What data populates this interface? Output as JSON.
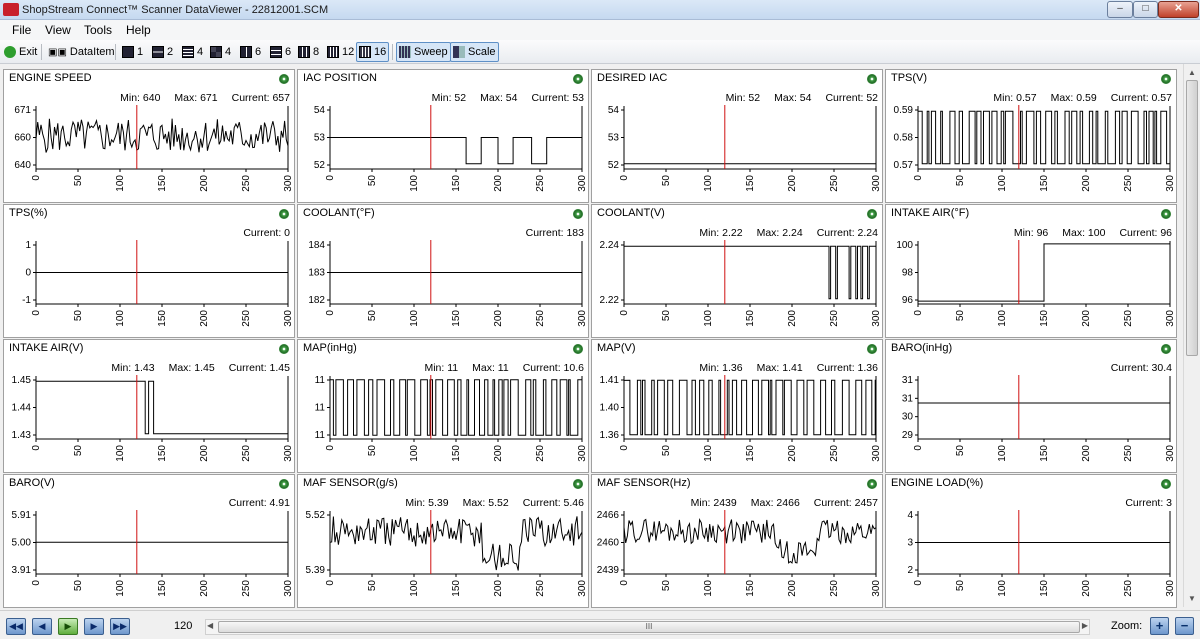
{
  "window": {
    "title": "ShopStream Connect™ Scanner DataViewer - 22812001.SCM",
    "min_label": "–",
    "max_label": "□",
    "close_label": "✕"
  },
  "menu": [
    "File",
    "View",
    "Tools",
    "Help"
  ],
  "toolbar": {
    "exit": "Exit",
    "dataitem": "DataItem",
    "layouts": [
      "1",
      "2",
      "4",
      "4",
      "6",
      "6",
      "8",
      "12",
      "16"
    ],
    "sweep": "Sweep",
    "scale": "Scale"
  },
  "panels": [
    {
      "title": "ENGINE SPEED",
      "min": "Min: 640",
      "max": "Max: 671",
      "current": "Current: 657",
      "yticks": [
        "671",
        "660",
        "640"
      ],
      "ylim": [
        638,
        674
      ],
      "trace": "noisy",
      "base": 657,
      "amp": 10
    },
    {
      "title": "IAC POSITION",
      "min": "Min: 52",
      "max": "Max: 54",
      "current": "Current: 53",
      "yticks": [
        "54",
        "53",
        "52"
      ],
      "ylim": [
        51.8,
        54.2
      ],
      "trace": "steps",
      "steps": [
        [
          0,
          53
        ],
        [
          162,
          53
        ],
        [
          162,
          52
        ],
        [
          180,
          52
        ],
        [
          180,
          53
        ],
        [
          200,
          53
        ],
        [
          200,
          52
        ],
        [
          218,
          52
        ],
        [
          218,
          53
        ],
        [
          240,
          53
        ],
        [
          240,
          52
        ],
        [
          258,
          52
        ],
        [
          258,
          53
        ],
        [
          300,
          53
        ]
      ]
    },
    {
      "title": "DESIRED IAC",
      "min": "Min: 52",
      "max": "Max: 54",
      "current": "Current: 52",
      "yticks": [
        "54",
        "53",
        "52"
      ],
      "ylim": [
        51.8,
        54.2
      ],
      "trace": "steps",
      "steps": [
        [
          0,
          52
        ],
        [
          300,
          52
        ]
      ]
    },
    {
      "title": "TPS(V)",
      "min": "Min: 0.57",
      "max": "Max: 0.59",
      "current": "Current: 0.57",
      "yticks": [
        "0.59",
        "0.58",
        "0.57"
      ],
      "ylim": [
        0.568,
        0.592
      ],
      "trace": "binary",
      "lo": 0.57,
      "hi": 0.59,
      "seed": 7
    },
    {
      "title": "TPS(%)",
      "min": "",
      "max": "",
      "current": "Current: 0",
      "yticks": [
        "1",
        "0",
        "-1"
      ],
      "ylim": [
        -1.1,
        1.1
      ],
      "trace": "steps",
      "steps": [
        [
          0,
          0
        ],
        [
          300,
          0
        ]
      ]
    },
    {
      "title": "COOLANT(°F)",
      "min": "",
      "max": "",
      "current": "Current: 183",
      "yticks": [
        "184",
        "183",
        "182"
      ],
      "ylim": [
        181.9,
        184.1
      ],
      "trace": "steps",
      "steps": [
        [
          0,
          183
        ],
        [
          300,
          183
        ]
      ]
    },
    {
      "title": "COOLANT(V)",
      "min": "Min: 2.22",
      "max": "Max: 2.24",
      "current": "Current: 2.24",
      "yticks": [
        "2.24",
        "2.22"
      ],
      "ylim": [
        2.218,
        2.242
      ],
      "trace": "steps",
      "steps": [
        [
          0,
          2.24
        ],
        [
          244,
          2.24
        ],
        [
          244,
          2.22
        ],
        [
          246,
          2.22
        ],
        [
          246,
          2.24
        ],
        [
          252,
          2.24
        ],
        [
          252,
          2.22
        ],
        [
          254,
          2.22
        ],
        [
          254,
          2.24
        ],
        [
          268,
          2.24
        ],
        [
          268,
          2.22
        ],
        [
          270,
          2.22
        ],
        [
          270,
          2.24
        ],
        [
          276,
          2.24
        ],
        [
          276,
          2.22
        ],
        [
          278,
          2.22
        ],
        [
          278,
          2.24
        ],
        [
          282,
          2.24
        ],
        [
          282,
          2.22
        ],
        [
          284,
          2.22
        ],
        [
          284,
          2.24
        ],
        [
          290,
          2.24
        ],
        [
          290,
          2.22
        ],
        [
          292,
          2.22
        ],
        [
          292,
          2.24
        ],
        [
          300,
          2.24
        ]
      ]
    },
    {
      "title": "INTAKE AIR(°F)",
      "min": "Min: 96",
      "max": "Max: 100",
      "current": "Current: 96",
      "yticks": [
        "100",
        "98",
        "96"
      ],
      "ylim": [
        95.8,
        100.2
      ],
      "trace": "steps",
      "steps": [
        [
          0,
          96
        ],
        [
          150,
          96
        ],
        [
          150,
          100
        ],
        [
          300,
          100
        ]
      ]
    },
    {
      "title": "INTAKE AIR(V)",
      "min": "Min: 1.43",
      "max": "Max: 1.45",
      "current": "Current: 1.45",
      "yticks": [
        "1.45",
        "1.44",
        "1.43"
      ],
      "ylim": [
        1.428,
        1.452
      ],
      "trace": "steps",
      "steps": [
        [
          0,
          1.45
        ],
        [
          130,
          1.45
        ],
        [
          130,
          1.43
        ],
        [
          134,
          1.43
        ],
        [
          134,
          1.45
        ],
        [
          140,
          1.45
        ],
        [
          140,
          1.43
        ],
        [
          300,
          1.43
        ]
      ]
    },
    {
      "title": "MAP(inHg)",
      "min": "Min: 11",
      "max": "Max: 11",
      "current": "Current: 10.6",
      "yticks": [
        "11",
        "11",
        "11"
      ],
      "ylim": [
        0,
        1
      ],
      "trace": "binary",
      "lo": 0.06,
      "hi": 0.94,
      "seed": 3
    },
    {
      "title": "MAP(V)",
      "min": "Min: 1.36",
      "max": "Max: 1.41",
      "current": "Current: 1.36",
      "yticks": [
        "1.41",
        "1.40",
        "1.36"
      ],
      "ylim": [
        1.356,
        1.414
      ],
      "trace": "binary",
      "lo": 1.36,
      "hi": 1.41,
      "seed": 11
    },
    {
      "title": "BARO(inHg)",
      "min": "",
      "max": "",
      "current": "Current: 30.4",
      "yticks": [
        "31",
        "31",
        "30",
        "29"
      ],
      "ylim": [
        28.8,
        31.6
      ],
      "trace": "steps",
      "steps": [
        [
          0,
          30.4
        ],
        [
          300,
          30.4
        ]
      ]
    },
    {
      "title": "BARO(V)",
      "min": "",
      "max": "",
      "current": "Current: 4.91",
      "yticks": [
        "5.91",
        "5.00",
        "3.91"
      ],
      "ylim": [
        3.8,
        6.0
      ],
      "trace": "steps",
      "steps": [
        [
          0,
          4.91
        ],
        [
          300,
          4.91
        ]
      ]
    },
    {
      "title": "MAF SENSOR(g/s)",
      "min": "Min: 5.39",
      "max": "Max: 5.52",
      "current": "Current: 5.46",
      "yticks": [
        "5.52",
        "5.39"
      ],
      "ylim": [
        5.385,
        5.525
      ],
      "trace": "noisy",
      "base": 5.48,
      "amp": 0.035,
      "dip": true
    },
    {
      "title": "MAF SENSOR(Hz)",
      "min": "Min: 2439",
      "max": "Max: 2466",
      "current": "Current: 2457",
      "yticks": [
        "2466",
        "2460",
        "2439"
      ],
      "ylim": [
        2437,
        2468
      ],
      "trace": "noisy",
      "base": 2458,
      "amp": 6,
      "dip": true
    },
    {
      "title": "ENGINE LOAD(%)",
      "min": "",
      "max": "",
      "current": "Current: 3",
      "yticks": [
        "4",
        "3",
        "2"
      ],
      "ylim": [
        1.9,
        4.1
      ],
      "trace": "steps",
      "steps": [
        [
          0,
          3
        ],
        [
          300,
          3
        ]
      ]
    }
  ],
  "xticks": [
    "0",
    "50",
    "100",
    "150",
    "200",
    "250",
    "300"
  ],
  "cursor_x": 120,
  "colors": {
    "trace": "#000000",
    "cursor": "#d01010"
  },
  "status": {
    "position": "120",
    "zoom_label": "Zoom:",
    "scroll_grip": "III"
  }
}
